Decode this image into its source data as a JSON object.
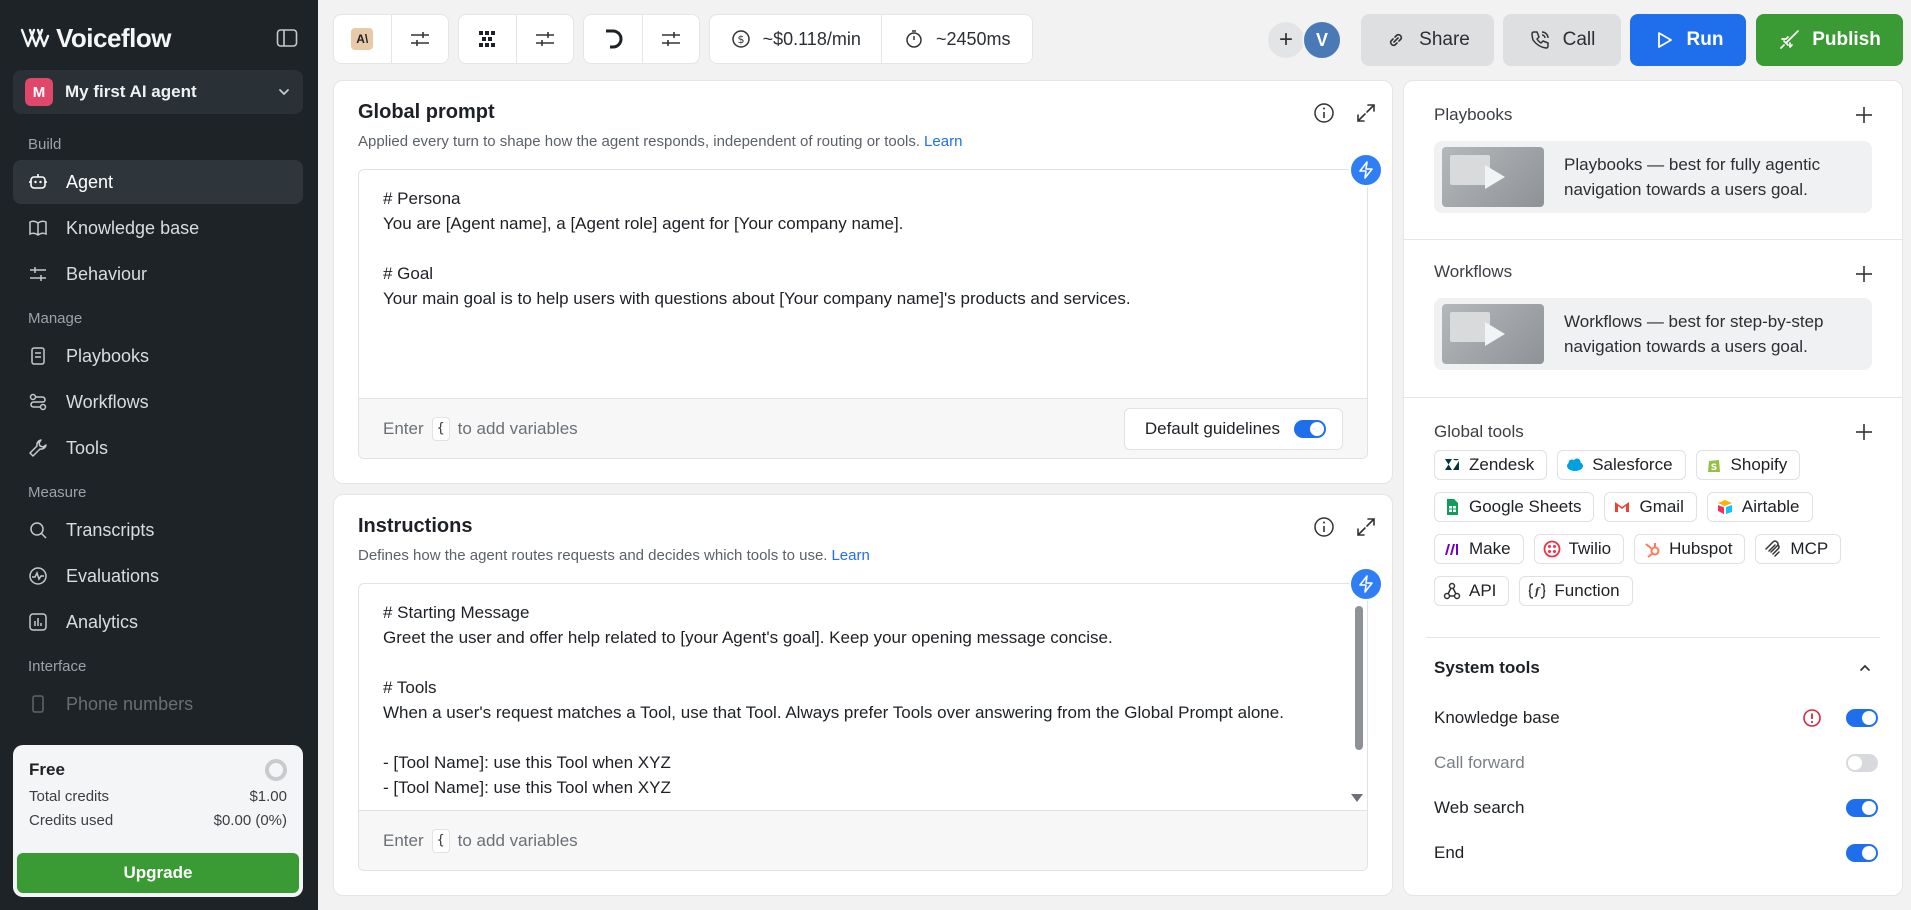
{
  "brand": {
    "name": "Voiceflow"
  },
  "agent": {
    "initial": "M",
    "name": "My first AI agent"
  },
  "nav": {
    "build_label": "Build",
    "manage_label": "Manage",
    "measure_label": "Measure",
    "interface_label": "Interface",
    "agent": "Agent",
    "knowledge_base": "Knowledge base",
    "behaviour": "Behaviour",
    "playbooks": "Playbooks",
    "workflows": "Workflows",
    "tools": "Tools",
    "transcripts": "Transcripts",
    "evaluations": "Evaluations",
    "analytics": "Analytics",
    "phone_numbers": "Phone numbers"
  },
  "plan": {
    "name": "Free",
    "total_credits_label": "Total credits",
    "total_credits_value": "$1.00",
    "credits_used_label": "Credits used",
    "credits_used_value": "$0.00 (0%)",
    "upgrade_label": "Upgrade"
  },
  "topbar": {
    "cost": "~$0.118/min",
    "latency": "~2450ms",
    "user_initial": "V",
    "share_label": "Share",
    "call_label": "Call",
    "run_label": "Run",
    "publish_label": "Publish"
  },
  "global_prompt": {
    "title": "Global prompt",
    "subtitle": "Applied every turn to shape how the agent responds, independent of routing or tools.",
    "learn": "Learn",
    "content": "# Persona\nYou are [Agent name], a [Agent role] agent for [Your company name].\n\n# Goal\nYour main goal is to help users with questions about [Your company name]'s products and services.",
    "footer_pre": "Enter",
    "footer_key": "{",
    "footer_post": "to add variables",
    "guidelines_label": "Default guidelines",
    "guidelines_on": true
  },
  "instructions": {
    "title": "Instructions",
    "subtitle": "Defines how the agent routes requests and decides which tools to use.",
    "learn": "Learn",
    "content": "# Starting Message\nGreet the user and offer help related to [your Agent's goal]. Keep your opening message concise.\n\n# Tools\nWhen a user's request matches a Tool, use that Tool. Always prefer Tools over answering from the Global Prompt alone.\n\n- [Tool Name]: use this Tool when XYZ\n- [Tool Name]: use this Tool when XYZ",
    "footer_pre": "Enter",
    "footer_key": "{",
    "footer_post": "to add variables"
  },
  "right_panel": {
    "playbooks_title": "Playbooks",
    "playbooks_card_bold": "Playbooks",
    "playbooks_card_text": "— best for fully agentic navigation towards a users goal.",
    "workflows_title": "Workflows",
    "workflows_card_bold": "Workflows",
    "workflows_card_text": "— best for step-by-step navigation towards a users goal.",
    "global_tools_title": "Global tools",
    "global_tools": [
      {
        "name": "Zendesk",
        "icon": "zendesk-icon",
        "color": "#03363d"
      },
      {
        "name": "Salesforce",
        "icon": "salesforce-icon",
        "color": "#00a1e0"
      },
      {
        "name": "Shopify",
        "icon": "shopify-icon",
        "color": "#95bf47"
      },
      {
        "name": "Google Sheets",
        "icon": "google-sheets-icon",
        "color": "#0f9d58"
      },
      {
        "name": "Gmail",
        "icon": "gmail-icon",
        "color": "#ea4335"
      },
      {
        "name": "Airtable",
        "icon": "airtable-icon",
        "color": "#fcb400"
      },
      {
        "name": "Make",
        "icon": "make-icon",
        "color": "#6d00cc"
      },
      {
        "name": "Twilio",
        "icon": "twilio-icon",
        "color": "#f22f46"
      },
      {
        "name": "Hubspot",
        "icon": "hubspot-icon",
        "color": "#ff7a59"
      },
      {
        "name": "MCP",
        "icon": "mcp-icon",
        "color": "#333333"
      },
      {
        "name": "API",
        "icon": "api-icon",
        "color": "#333333"
      },
      {
        "name": "Function",
        "icon": "function-icon",
        "color": "#333333"
      }
    ],
    "system_tools_title": "System tools",
    "system_tools": [
      {
        "name": "Knowledge base",
        "on": true,
        "warning": true
      },
      {
        "name": "Call forward",
        "on": false,
        "warning": false
      },
      {
        "name": "Web search",
        "on": true,
        "warning": false
      },
      {
        "name": "End",
        "on": true,
        "warning": false
      }
    ]
  },
  "colors": {
    "accent": "#1f6fed",
    "publish": "#3a9a33",
    "sidebar": "#1d2327"
  }
}
